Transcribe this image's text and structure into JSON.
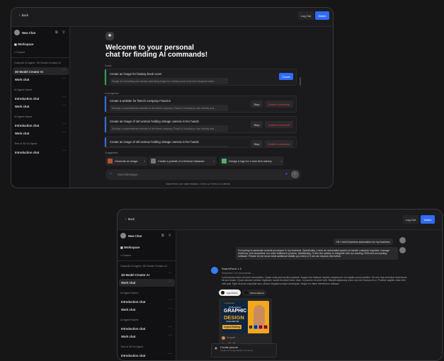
{
  "window1": {
    "back": "Back",
    "logout": "Log Out",
    "wallet": "Wallet",
    "sidebar": {
      "new_chat": "New Chat",
      "workspace": "Workspace",
      "search": "Search",
      "groups": [
        {
          "title": "GraphAI AI Agent: 3D Model Creator AI",
          "items": [
            "3D Model Creator AI",
            "Work chat"
          ]
        },
        {
          "title": "AI Agent Name",
          "items": [
            "Introduction chat",
            "Work chat"
          ]
        },
        {
          "title": "AI Agent Name",
          "items": [
            "Introduction chat",
            "Work chat"
          ]
        },
        {
          "title": "Test of 3D AI Agent",
          "items": [
            "Introduction chat"
          ]
        }
      ]
    },
    "title_line1": "Welcome to your personal",
    "title_line2": "chat for finding AI commands!",
    "done_label": "Done:",
    "in_progress_label": "In progress:",
    "done": {
      "title": "Create an image for fantasy book cover",
      "desc": "Design an enchanting and visually captivating image for a fantasy book cover that transports reade...",
      "action": "Check"
    },
    "progress": [
      {
        "title": "Create a website for fintech company FinanCe",
        "desc": "Develop a comprehensive website for the fintech company, FinanCe, focusing on user-friendly desi..."
      },
      {
        "title": "Create an image of old woman holding vintage camera in her hands",
        "desc": "Develop a comprehensive website for the fintech company, FinanCe, focusing on user-friendly desi..."
      },
      {
        "title": "Create an image of old woman holding vintage camera in her hands",
        "desc": ""
      }
    ],
    "stop": "Stop",
    "delete": "Delete command",
    "suggested_label": "Suggested:",
    "suggestions": [
      "Generate an image",
      "Create a portrait of a fictional character",
      "Design a logo for a new tech startup"
    ],
    "input_placeholder": "Send Message...",
    "footer": "SwarmForce can make mistakes. Check our Terms & Conditions."
  },
  "window2": {
    "back": "Back",
    "logout": "Log Out",
    "wallet": "Wallet",
    "sidebar": {
      "new_chat": "New Chat",
      "workspace": "Workspace",
      "search": "Search",
      "groups": [
        {
          "title": "GraphAI AI Agent: 3D Model Creator AI",
          "items": [
            "3D Model Creator AI",
            "Work chat"
          ]
        },
        {
          "title": "AI Agent Name",
          "items": [
            "Introduction chat",
            "Work chat"
          ]
        },
        {
          "title": "AI Agent Name",
          "items": [
            "Introduction chat",
            "Work chat"
          ]
        },
        {
          "title": "Test of 3D AI Agent",
          "items": [
            "Introduction chat"
          ]
        }
      ]
    },
    "msg1": "Hi! I need business automation for my business",
    "msg2": "I'm looking to automate several processes in my business. Specifically, I need an automated system to handle customer inquiries, manage inventory, and streamline our order fulfillment process. Additionally, I'd like the system to integrate with our existing CRM and accounting software. Please let me know what additional details you need or if we can discuss this further.",
    "bot_name": "SwarmForce 1.0",
    "searched": "Searched 2 AI commands",
    "bot_text": "Lorem ipsum dolor sit amet consectetur. Quam nulla quis iaculis praesent. Augue sed tristique montes volutpat vel orci sapien purus porttitor. Sit orci cras senectus amet lacus sit sed ornare. Quam aenean pretium dignissim iaculis tincidunt tortor vitae. A posuere sit amet velit. Blandit adipiscing tortor non nisl rhoncus id ut. Porttitor sagittis vitae nibh velit quis. Eget sit proin vulputate arcu ultrices fringilla suscipit consequat. Neque eu etiam elementum tristique.",
    "agents": [
      "AgentSoftio",
      "MarketingDeva"
    ],
    "image": {
      "small": "YOUR AD HERE",
      "tag": "Professional",
      "big1": "GRAPHIC",
      "big2": "DESIGN",
      "sub": "LOGO•VECTOR",
      "badge": "Urgent Editing",
      "tools": [
        "Ai",
        "Ps",
        "Id",
        "Ar"
      ]
    },
    "author": "Anayat",
    "card_title": "AssetBotBox",
    "popup_title": "Create picture",
    "popup_desc": "Create an image based on prompt"
  },
  "colors": {
    "accent": "#2f6bff",
    "done": "#2e9d4f",
    "progress": "#2f6bff",
    "danger": "#e0413a"
  }
}
